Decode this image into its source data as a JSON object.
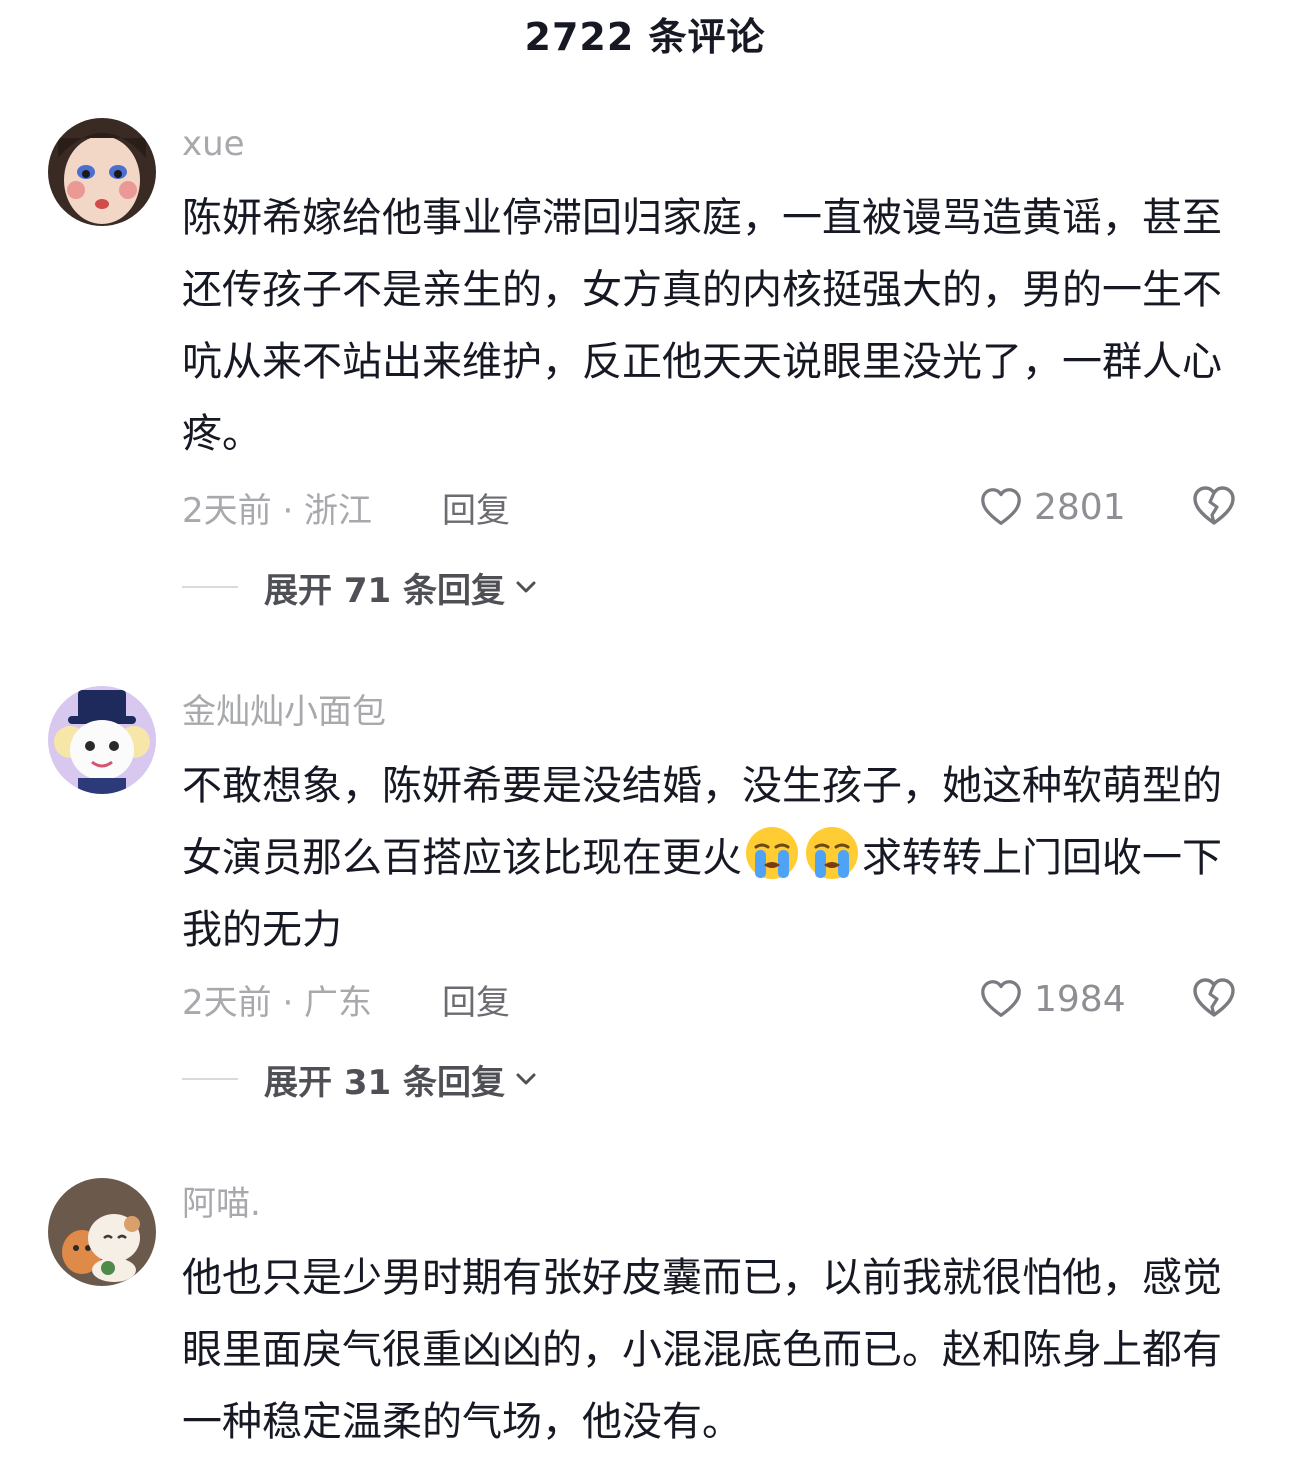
{
  "header": {
    "title": "2722 条评论"
  },
  "comments": [
    {
      "username": "xue",
      "text": "陈妍希嫁给他事业停滞回归家庭，一直被谩骂造黄谣，甚至还传孩子不是亲生的，女方真的内核挺强大的，男的一生不吭从来不站出来维护，反正他天天说眼里没光了，一群人心疼。",
      "time_location": "2天前 · 浙江",
      "reply_label": "回复",
      "likes": "2801",
      "expand_label": "展开 71 条回复"
    },
    {
      "username": "金灿灿小面包",
      "text_part1": "不敢想象，陈妍希要是没结婚，没生孩子，她这种软萌型的女演员那么百搭应该比现在更火",
      "text_part2": "求转转上门回收一下我的无力",
      "emoji": "loudly-crying-face",
      "time_location": "2天前 · 广东",
      "reply_label": "回复",
      "likes": "1984",
      "expand_label": "展开 31 条回复"
    },
    {
      "username": "阿喵.",
      "text": "他也只是少男时期有张好皮囊而已，以前我就很怕他，感觉眼里面戾气很重凶凶的，小混混底色而已。赵和陈身上都有一种稳定温柔的气场，他没有。"
    }
  ],
  "icons": {
    "like": "heart-outline-icon",
    "dislike": "broken-heart-icon",
    "expand": "chevron-down-icon"
  },
  "colors": {
    "text_primary": "#161823",
    "text_secondary": "#a8a9ad",
    "reply": "#6b6c72"
  }
}
